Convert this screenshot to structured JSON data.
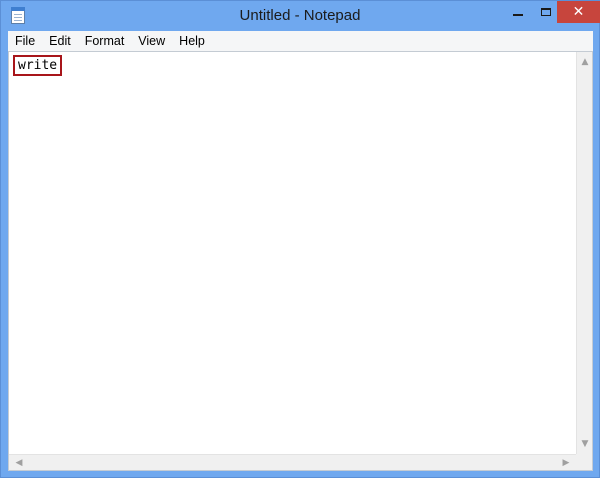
{
  "window": {
    "title": "Untitled - Notepad",
    "minimize_icon": "minimize-icon",
    "maximize_icon": "maximize-icon",
    "close_icon": "close-icon",
    "close_glyph": "✕"
  },
  "menu": {
    "items": [
      "File",
      "Edit",
      "Format",
      "View",
      "Help"
    ]
  },
  "editor": {
    "content": "write",
    "highlight_color": "#a8151a"
  },
  "scrollbars": {
    "up_glyph": "▲",
    "down_glyph": "▼",
    "left_glyph": "◀",
    "right_glyph": "▶"
  },
  "colors": {
    "titlebar": "#6fa8ef",
    "close_button": "#c7453d",
    "menubar": "#f5f6f7"
  }
}
